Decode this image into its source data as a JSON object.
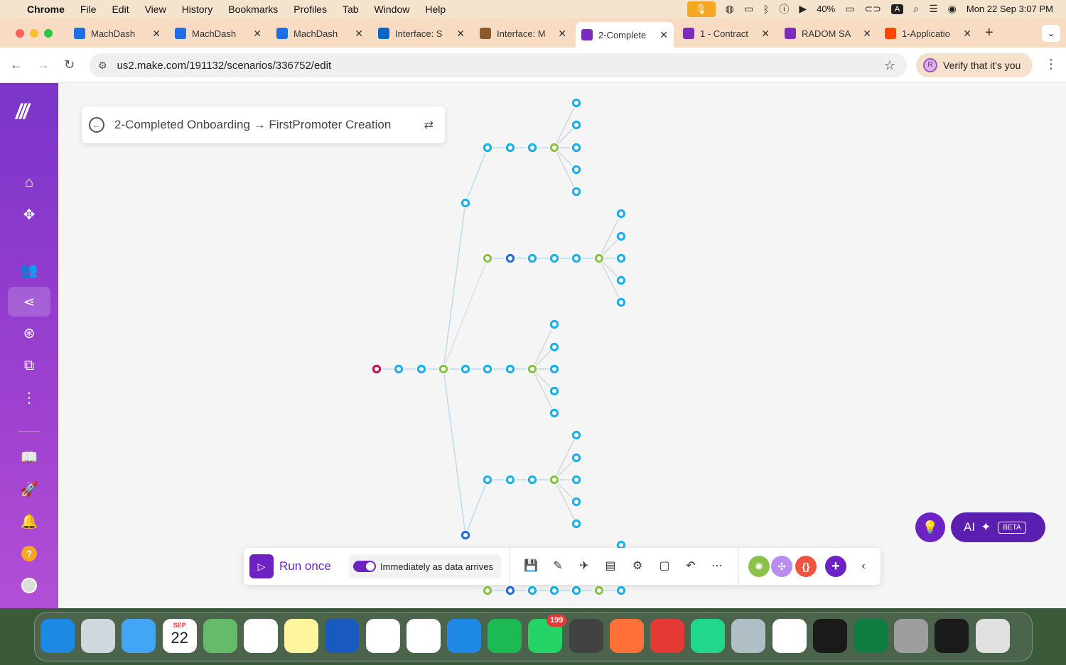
{
  "menubar": {
    "app": "Chrome",
    "items": [
      "File",
      "Edit",
      "View",
      "History",
      "Bookmarks",
      "Profiles",
      "Tab",
      "Window",
      "Help"
    ],
    "battery": "40%",
    "input_source": "A",
    "datetime": "Mon 22 Sep  3:07 PM"
  },
  "tabs": [
    {
      "title": "MachDash",
      "favicon_color": "#1e6ee8",
      "active": false
    },
    {
      "title": "MachDash",
      "favicon_color": "#1e6ee8",
      "active": false
    },
    {
      "title": "MachDash",
      "favicon_color": "#1e6ee8",
      "active": false
    },
    {
      "title": "Interface: S",
      "favicon_color": "#0a66c2",
      "active": false
    },
    {
      "title": "Interface: M",
      "favicon_color": "#8a5a2b",
      "active": false
    },
    {
      "title": "2-Complete",
      "favicon_color": "#7b2cbf",
      "active": true
    },
    {
      "title": "1 - Contract",
      "favicon_color": "#7b2cbf",
      "active": false
    },
    {
      "title": "RADOM SA",
      "favicon_color": "#7b2cbf",
      "active": false
    },
    {
      "title": "1-Applicatio",
      "favicon_color": "#ff4500",
      "active": false
    }
  ],
  "address_bar": {
    "url": "us2.make.com/191132/scenarios/336752/edit"
  },
  "profile_button": {
    "label": "Verify that it's you",
    "initial": "R"
  },
  "scenario": {
    "title": "2-Completed Onboarding → FirstPromoter Creation"
  },
  "bottom_toolbar": {
    "run_label": "Run once",
    "schedule_label": "Immediately as data arrives",
    "schedule_on": true,
    "colors": {
      "accent": "#6d22c4",
      "green": "#8bc34a",
      "violet": "#b98cf0",
      "red": "#f0533f"
    }
  },
  "ai_button": {
    "label": "AI",
    "badge": "BETA"
  },
  "sidebar_icons": [
    "home-icon",
    "templates-icon",
    "team-icon",
    "scenarios-icon",
    "connections-icon",
    "apps-icon",
    "more-icon",
    "docs-icon",
    "launch-icon",
    "notifications-icon",
    "help-icon",
    "profile-icon"
  ],
  "dock": {
    "apps": [
      {
        "name": "Finder",
        "color": "#1e88e5"
      },
      {
        "name": "Launchpad",
        "color": "#cfd8dc"
      },
      {
        "name": "Mail",
        "color": "#42a5f5"
      },
      {
        "name": "Calendar",
        "color": "#ffffff",
        "day": "22",
        "month": "SEP"
      },
      {
        "name": "Maps",
        "color": "#66bb6a"
      },
      {
        "name": "Reminders",
        "color": "#ffffff"
      },
      {
        "name": "Notes",
        "color": "#fff59d"
      },
      {
        "name": "Word",
        "color": "#185abd"
      },
      {
        "name": "Photos",
        "color": "#ffffff"
      },
      {
        "name": "Chrome",
        "color": "#ffffff"
      },
      {
        "name": "App Store",
        "color": "#1e88e5"
      },
      {
        "name": "Spotify",
        "color": "#1db954"
      },
      {
        "name": "WhatsApp",
        "color": "#25d366",
        "badge": "199"
      },
      {
        "name": "Calculator",
        "color": "#424242"
      },
      {
        "name": "Firefox",
        "color": "#ff7139"
      },
      {
        "name": "TickTick",
        "color": "#e53935"
      },
      {
        "name": "PyCharm",
        "color": "#21d789"
      },
      {
        "name": "iPhone Mirroring",
        "color": "#b0bec5"
      },
      {
        "name": "Slack",
        "color": "#ffffff"
      },
      {
        "name": "Edge",
        "color": "#1a1a1a"
      },
      {
        "name": "Excel",
        "color": "#107c41"
      },
      {
        "name": "System Settings",
        "color": "#9e9e9e"
      },
      {
        "name": "Upwork",
        "color": "#1a1a1a"
      },
      {
        "name": "Trash",
        "color": "#e0e0e0"
      }
    ]
  }
}
